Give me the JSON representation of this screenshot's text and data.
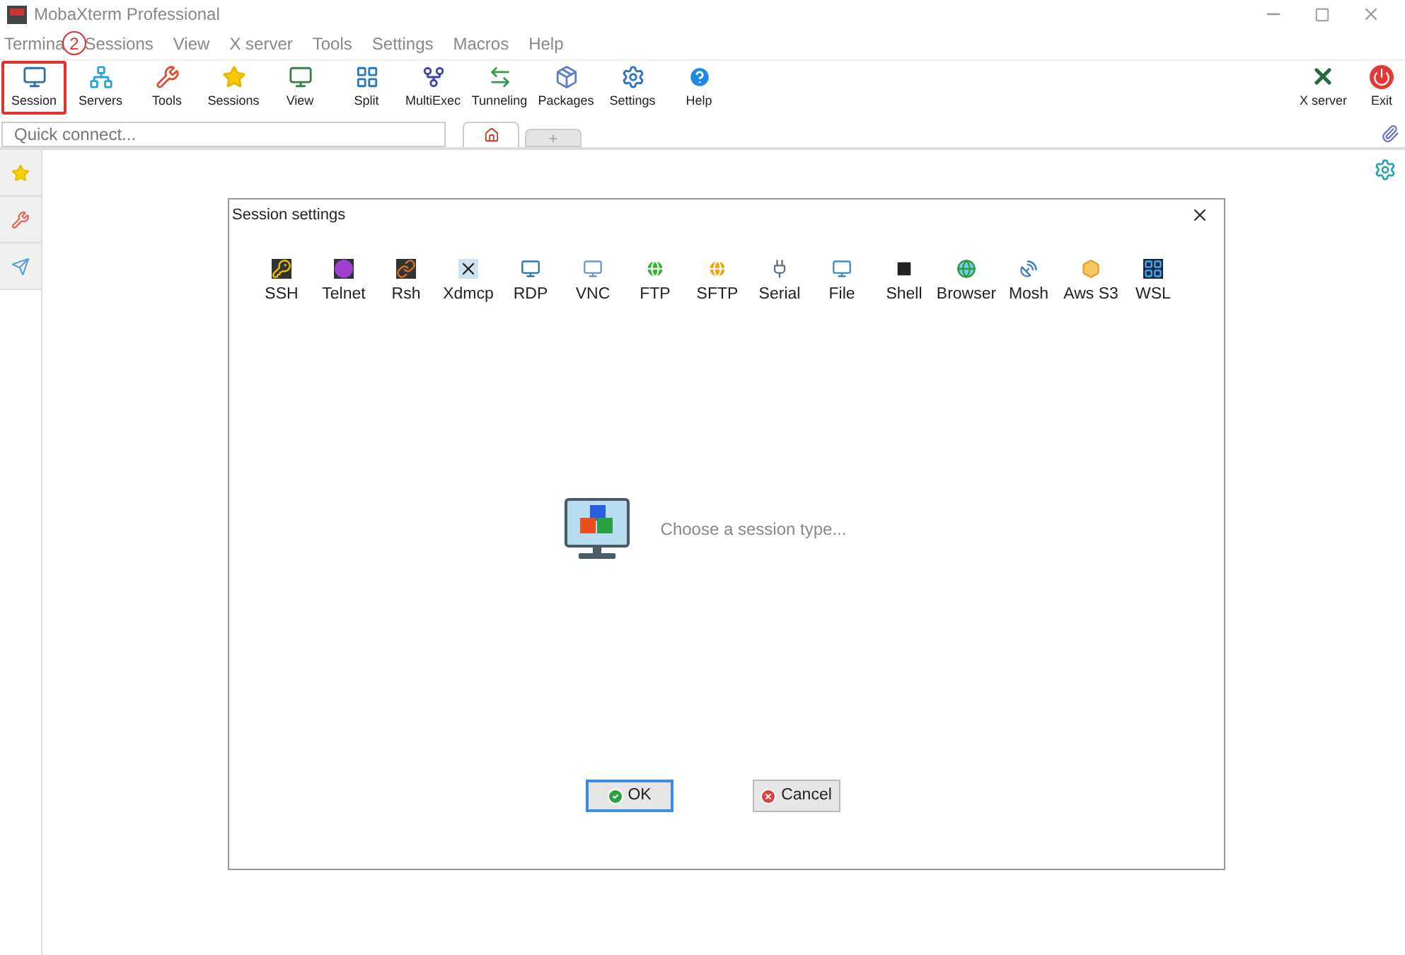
{
  "window": {
    "title": "MobaXterm Professional"
  },
  "menu": [
    "Termina",
    "Sessions",
    "View",
    "X server",
    "Tools",
    "Settings",
    "Macros",
    "Help"
  ],
  "annotation": {
    "number": "2"
  },
  "toolbar": [
    {
      "label": "Session",
      "highlighted": true
    },
    {
      "label": "Servers",
      "highlighted": false
    },
    {
      "label": "Tools",
      "highlighted": false
    },
    {
      "label": "Sessions",
      "highlighted": false
    },
    {
      "label": "View",
      "highlighted": false
    },
    {
      "label": "Split",
      "highlighted": false
    },
    {
      "label": "MultiExec",
      "highlighted": false
    },
    {
      "label": "Tunneling",
      "highlighted": false
    },
    {
      "label": "Packages",
      "highlighted": false
    },
    {
      "label": "Settings",
      "highlighted": false
    },
    {
      "label": "Help",
      "highlighted": false
    }
  ],
  "toolbar_right": [
    "X server",
    "Exit"
  ],
  "quick_connect": {
    "placeholder": "Quick connect..."
  },
  "tabs": [
    {
      "kind": "home",
      "selected": true
    },
    {
      "kind": "new",
      "selected": false
    }
  ],
  "dialog": {
    "title": "Session settings",
    "session_types": [
      "SSH",
      "Telnet",
      "Rsh",
      "Xdmcp",
      "RDP",
      "VNC",
      "FTP",
      "SFTP",
      "Serial",
      "File",
      "Shell",
      "Browser",
      "Mosh",
      "Aws S3",
      "WSL"
    ],
    "prompt": "Choose a session type...",
    "buttons": [
      {
        "kind": "ok",
        "label": "OK"
      },
      {
        "kind": "cancel",
        "label": "Cancel"
      }
    ]
  }
}
